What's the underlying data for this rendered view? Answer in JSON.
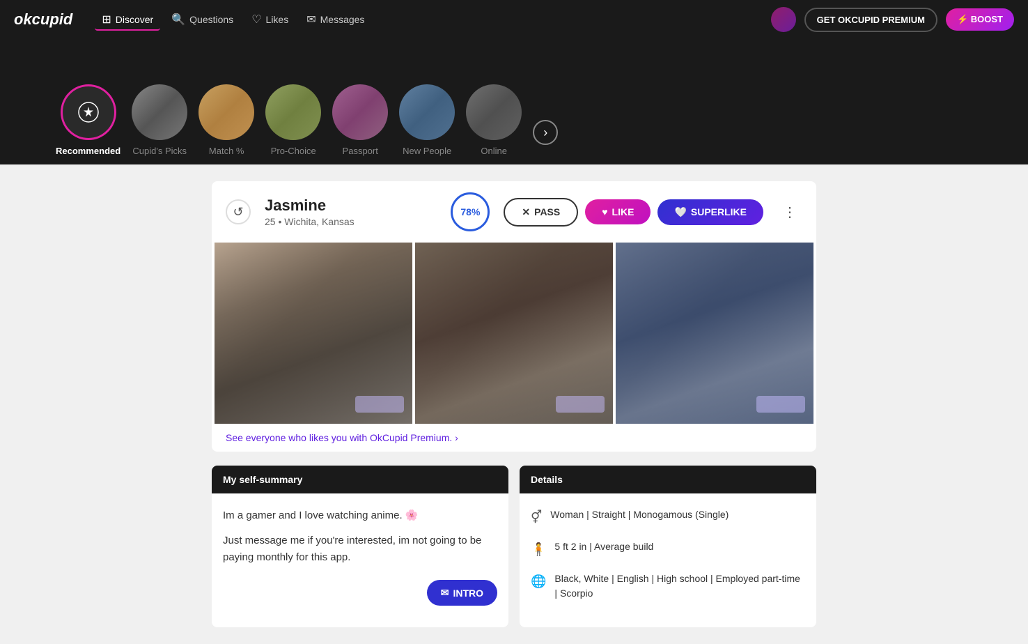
{
  "app": {
    "logo": "okcupid",
    "premium_btn": "GET OKCUPID PREMIUM",
    "boost_btn": "⚡ BOOST"
  },
  "nav": {
    "items": [
      {
        "id": "discover",
        "label": "Discover",
        "icon": "⊞",
        "active": true
      },
      {
        "id": "questions",
        "label": "Questions",
        "icon": "🔍"
      },
      {
        "id": "likes",
        "label": "Likes",
        "icon": "♡"
      },
      {
        "id": "messages",
        "label": "Messages",
        "icon": "✉"
      }
    ]
  },
  "categories": [
    {
      "id": "recommended",
      "label": "Recommended",
      "active": true,
      "icon": "✦"
    },
    {
      "id": "cupids-picks",
      "label": "Cupid's Picks",
      "active": false
    },
    {
      "id": "match",
      "label": "Match %",
      "active": false
    },
    {
      "id": "pro-choice",
      "label": "Pro-Choice",
      "active": false
    },
    {
      "id": "passport",
      "label": "Passport",
      "active": false
    },
    {
      "id": "new-people",
      "label": "New People",
      "active": false
    },
    {
      "id": "online",
      "label": "Online",
      "active": false
    }
  ],
  "profile": {
    "name": "Jasmine",
    "age": "25",
    "location": "Wichita, Kansas",
    "match_percent": "78%",
    "pass_label": "PASS",
    "like_label": "LIKE",
    "superlike_label": "SUPERLIKE",
    "premium_link": "See everyone who likes you with OkCupid Premium. ›",
    "self_summary_header": "My self-summary",
    "self_summary_1": "Im a gamer and I love watching anime. 🌸",
    "self_summary_2": "Just message me if you're interested, im not going to be paying monthly for this app.",
    "details_header": "Details",
    "details": [
      {
        "icon": "⚥",
        "text": "Woman | Straight | Monogamous (Single)"
      },
      {
        "icon": "🧍",
        "text": "5 ft 2 in | Average build"
      },
      {
        "icon": "🌐",
        "text": "Black, White | English | High school | Employed part-time | Scorpio"
      }
    ],
    "intro_btn": "INTRO"
  }
}
